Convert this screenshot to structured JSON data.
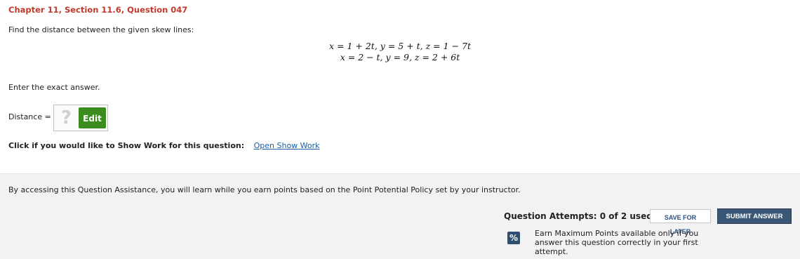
{
  "question": {
    "title": "Chapter 11, Section 11.6, Question 047",
    "prompt": "Find the distance between the given skew lines:",
    "equations": [
      "x = 1 + 2t, y = 5 + t, z = 1 − 7t",
      "x = 2 − t, y = 9, z = 2 + 6t"
    ],
    "exact_note": "Enter the exact answer.",
    "answer_label": "Distance =",
    "answer_placeholder_icon": "?",
    "edit_label": "Edit"
  },
  "show_work": {
    "label": "Click if you would like to Show Work for this question:",
    "link": "Open Show Work"
  },
  "assistance": {
    "text": "By accessing this Question Assistance, you will learn while you earn points based on the Point Potential Policy set by your instructor.",
    "attempts": "Question Attempts: 0 of 2 used",
    "save_label": "SAVE FOR LATER",
    "submit_label": "SUBMIT ANSWER",
    "percent_icon": "%",
    "earn_text": "Earn Maximum Points available only if you answer this question correctly in your first attempt."
  },
  "colors": {
    "title": "#c0392b",
    "edit_button": "#3a8d1e",
    "link": "#1a5fa8",
    "submit_button": "#3a5876",
    "panel_background": "#f2f2f2"
  }
}
